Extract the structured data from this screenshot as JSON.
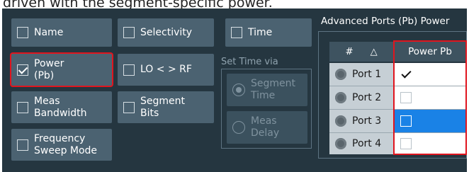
{
  "caption": "driven with the segment-specific power.",
  "columns_checkboxes": [
    {
      "id": "name",
      "label": "Name",
      "checked": false
    },
    {
      "id": "power",
      "label": "Power\n(Pb)",
      "checked": true
    },
    {
      "id": "meas-bw",
      "label": "Meas\nBandwidth",
      "checked": false
    },
    {
      "id": "freq-sweep",
      "label": "Frequency\nSweep Mode",
      "checked": false
    },
    {
      "id": "selectivity",
      "label": "Selectivity",
      "checked": false
    },
    {
      "id": "lo-rf",
      "label": "LO < > RF",
      "checked": false
    },
    {
      "id": "seg-bits",
      "label": "Segment\nBits",
      "checked": false
    },
    {
      "id": "time",
      "label": "Time",
      "checked": false
    }
  ],
  "set_time_via": {
    "label": "Set Time via",
    "options": [
      {
        "label": "Segment\nTime",
        "selected": true
      },
      {
        "label": "Meas\nDelay",
        "selected": false
      }
    ]
  },
  "ports_table": {
    "title": "Advanced Ports (Pb) Power",
    "col_port": "#",
    "sort_icon": "△",
    "col_power": "Power Pb",
    "rows": [
      {
        "port": "Port 1",
        "checked": true,
        "selected": false
      },
      {
        "port": "Port 2",
        "checked": false,
        "selected": false
      },
      {
        "port": "Port 3",
        "checked": false,
        "selected": true
      },
      {
        "port": "Port 4",
        "checked": false,
        "selected": false
      }
    ]
  },
  "colors": {
    "panel": "#253640",
    "button": "#4b6271",
    "highlight": "#e0151e",
    "selection": "#1a82e6"
  }
}
